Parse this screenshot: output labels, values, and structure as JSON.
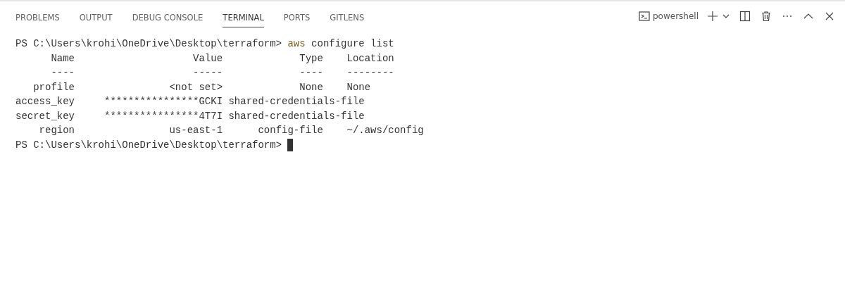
{
  "tabs": [
    {
      "label": "PROBLEMS",
      "selected": false
    },
    {
      "label": "OUTPUT",
      "selected": false
    },
    {
      "label": "DEBUG CONSOLE",
      "selected": false
    },
    {
      "label": "TERMINAL",
      "selected": true
    },
    {
      "label": "PORTS",
      "selected": false
    },
    {
      "label": "GITLENS",
      "selected": false
    }
  ],
  "terminal_name": "powershell",
  "lines": [
    {
      "kind": "prompt",
      "prompt": "PS C:\\Users\\krohi\\OneDrive\\Desktop\\terraform>",
      "command": "aws",
      "args": "configure list"
    },
    {
      "kind": "output",
      "text": "      Name                    Value             Type    Location"
    },
    {
      "kind": "output",
      "text": "      ----                    -----             ----    --------"
    },
    {
      "kind": "output",
      "text": "   profile                <not set>             None    None"
    },
    {
      "kind": "output",
      "text": "access_key     ****************GCKI shared-credentials-file"
    },
    {
      "kind": "output",
      "text": "secret_key     ****************4T7I shared-credentials-file"
    },
    {
      "kind": "output",
      "text": "    region                us-east-1      config-file    ~/.aws/config"
    },
    {
      "kind": "prompt",
      "prompt": "PS C:\\Users\\krohi\\OneDrive\\Desktop\\terraform>",
      "cursor": true
    }
  ]
}
